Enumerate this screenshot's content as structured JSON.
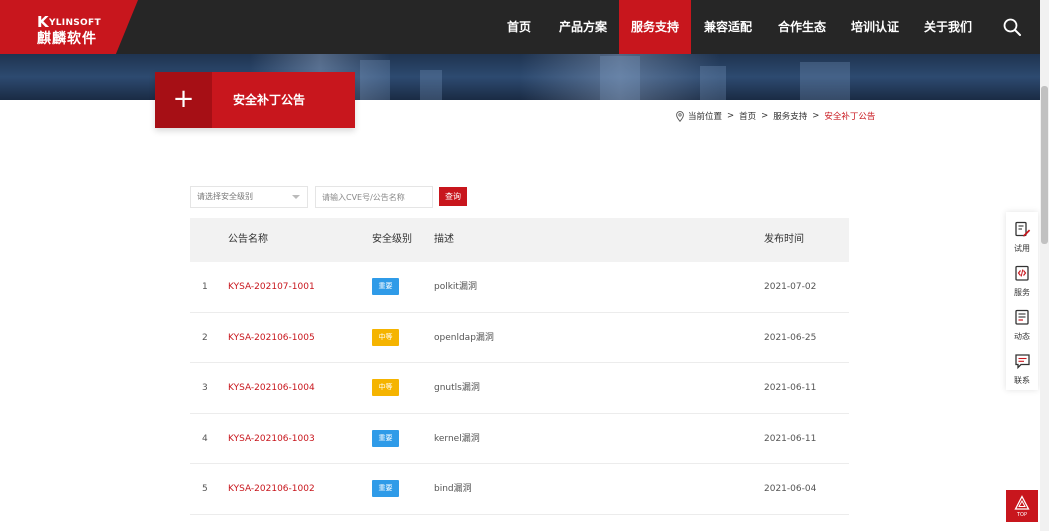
{
  "logo": {
    "en_initial": "K",
    "en_rest": "YLINSOFT",
    "cn": "麒麟软件"
  },
  "nav": {
    "items": [
      {
        "label": "首页"
      },
      {
        "label": "产品方案"
      },
      {
        "label": "服务支持"
      },
      {
        "label": "兼容适配"
      },
      {
        "label": "合作生态"
      },
      {
        "label": "培训认证"
      },
      {
        "label": "关于我们"
      }
    ],
    "active_index": 2
  },
  "title_block": {
    "plus": "+",
    "title": "安全补丁公告"
  },
  "breadcrumb": {
    "prefix": "当前位置",
    "sep": ">",
    "home": "首页",
    "section": "服务支持",
    "current": "安全补丁公告"
  },
  "filters": {
    "level_placeholder": "请选择安全级别",
    "search_placeholder": "请输入CVE号/公告名称",
    "query_label": "查询"
  },
  "table": {
    "headers": {
      "name": "公告名称",
      "level": "安全级别",
      "desc": "描述",
      "date": "发布时间"
    },
    "rows": [
      {
        "index": "1",
        "name": "KYSA-202107-1001",
        "level": "重要",
        "desc": "polkit漏洞",
        "date": "2021-07-02"
      },
      {
        "index": "2",
        "name": "KYSA-202106-1005",
        "level": "中等",
        "desc": "openldap漏洞",
        "date": "2021-06-25"
      },
      {
        "index": "3",
        "name": "KYSA-202106-1004",
        "level": "中等",
        "desc": "gnutls漏洞",
        "date": "2021-06-11"
      },
      {
        "index": "4",
        "name": "KYSA-202106-1003",
        "level": "重要",
        "desc": "kernel漏洞",
        "date": "2021-06-11"
      },
      {
        "index": "5",
        "name": "KYSA-202106-1002",
        "level": "重要",
        "desc": "bind漏洞",
        "date": "2021-06-04"
      }
    ]
  },
  "level_colors": {
    "重要": "#2f9be8",
    "中等": "#f5b400"
  },
  "side_bar": {
    "items": [
      {
        "label": "试用",
        "icon": "trial-icon"
      },
      {
        "label": "服务",
        "icon": "service-icon"
      },
      {
        "label": "动态",
        "icon": "news-icon"
      },
      {
        "label": "联系",
        "icon": "contact-icon"
      }
    ]
  },
  "top_button": {
    "label": "TOP"
  },
  "colors": {
    "brand_red": "#c8161d",
    "nav_bg": "#262626"
  }
}
